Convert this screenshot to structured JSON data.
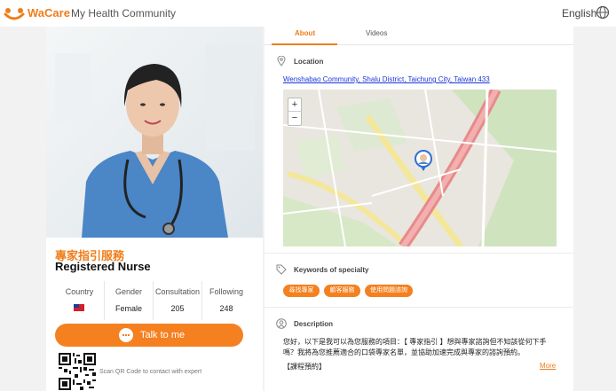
{
  "header": {
    "brand": "WaCare",
    "subtitle": "My Health Community",
    "language": "English",
    "brand_color": "#f07d1a"
  },
  "profile": {
    "service_title": "專家指引服務",
    "role": "Registered Nurse",
    "stats": [
      {
        "label": "Country",
        "value": "",
        "flag": "Taiwan"
      },
      {
        "label": "Gender",
        "value": "Female"
      },
      {
        "label": "Consultation",
        "value": "205"
      },
      {
        "label": "Following",
        "value": "248"
      }
    ],
    "talk_button": "Talk to me",
    "qr_text": "Scan QR Code to contact with expert"
  },
  "tabs": [
    {
      "label": "About",
      "active": true
    },
    {
      "label": "Videos",
      "active": false
    }
  ],
  "location": {
    "title": "Location",
    "address": "Wenshabao Community, Shalu District, Taichung City, Taiwan 433",
    "zoom_in": "+",
    "zoom_out": "−"
  },
  "keywords": {
    "title": "Keywords of specialty",
    "items": [
      "尋找專家",
      "顧客服務",
      "使用問題諮詢"
    ]
  },
  "description": {
    "title": "Description",
    "text": "您好，以下是我可以為您服務的項目：【 專家指引 】想與專家諮詢但不知該從何下手嗎？我將為您推薦適合的口袋專家名單，並協助加速完成與專家的諮詢預約。",
    "line2": "【課程預約】",
    "more": "More"
  }
}
